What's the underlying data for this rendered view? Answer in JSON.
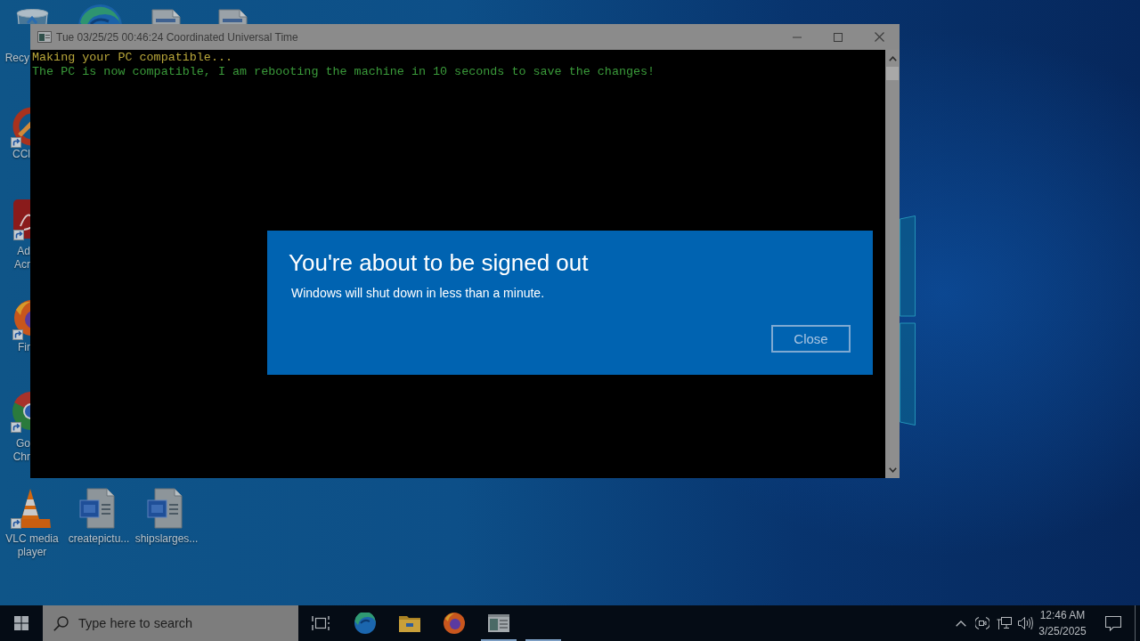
{
  "desktop": {
    "icons": [
      {
        "kind": "recycle-bin",
        "label": "Recy",
        "shortcut": false
      },
      {
        "kind": "edge",
        "shortcut": false
      },
      {
        "kind": "document",
        "shortcut": false
      },
      {
        "kind": "document",
        "shortcut": false
      },
      {
        "kind": "ccleaner",
        "label": "CCl",
        "shortcut": true
      },
      {
        "kind": "acrobat",
        "label": "Ad Acr",
        "shortcut": true
      },
      {
        "kind": "firefox",
        "label": "Fir",
        "shortcut": true
      },
      {
        "kind": "chrome",
        "label": "Go Chr",
        "shortcut": true
      },
      {
        "kind": "vlc",
        "label": "VLC media player",
        "shortcut": true
      },
      {
        "kind": "word",
        "label": "createpictu...",
        "shortcut": false
      },
      {
        "kind": "word",
        "label": "shipslarges...",
        "shortcut": false
      }
    ]
  },
  "console": {
    "title": "Tue 03/25/25 00:46:24 Coordinated Universal Time",
    "lines": [
      {
        "text": "Making your PC compatible...",
        "color": "#b8a63a"
      },
      {
        "text": "The PC is now compatible, I am rebooting the machine in 10 seconds to save the changes!",
        "color": "#3a9a3a"
      }
    ]
  },
  "dialog": {
    "title": "You're about to be signed out",
    "message": "Windows will shut down in less than a minute.",
    "buttons": [
      "Close"
    ]
  },
  "taskbar": {
    "search": {
      "placeholder": "Type here to search"
    },
    "apps": [
      {
        "kind": "task-view",
        "running": false
      },
      {
        "kind": "edge",
        "running": false
      },
      {
        "kind": "file-explorer",
        "running": false
      },
      {
        "kind": "firefox",
        "running": false
      },
      {
        "kind": "console",
        "running": true
      },
      {
        "kind": "blank",
        "running": true
      }
    ],
    "tray": {
      "time": "12:46 AM",
      "date": "3/25/2025"
    }
  }
}
